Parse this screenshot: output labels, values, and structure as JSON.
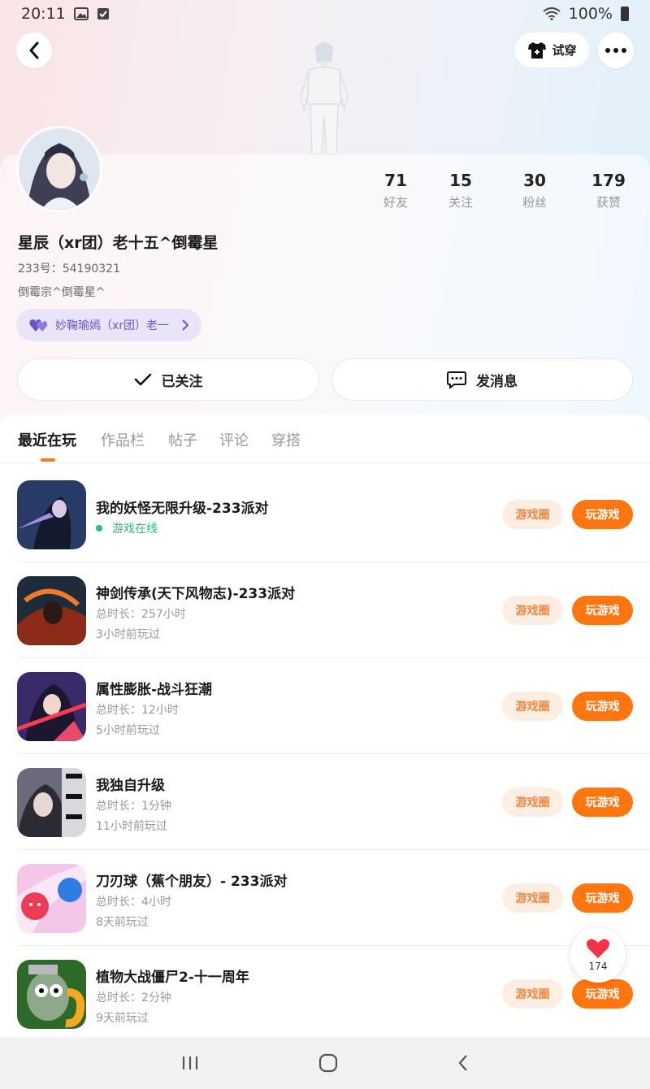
{
  "status_bar": {
    "time": "20:11",
    "battery": "100%"
  },
  "header": {
    "tryon_label": "试穿"
  },
  "profile": {
    "stats": [
      {
        "num": "71",
        "label": "好友"
      },
      {
        "num": "15",
        "label": "关注"
      },
      {
        "num": "30",
        "label": "粉丝"
      },
      {
        "num": "179",
        "label": "获赞"
      }
    ],
    "name": "星辰（xr团）老十五^倒霉星",
    "id_label": "233号：",
    "id_value": "54190321",
    "bio": "倒霉宗^倒霉星^",
    "family_tag": "妙鞠瑜嫣（xr团）老一",
    "follow_label": "已关注",
    "message_label": "发消息"
  },
  "tabs": [
    "最近在玩",
    "作品栏",
    "帖子",
    "评论",
    "穿搭"
  ],
  "games": [
    {
      "title": "我的妖怪无限升级-233派对",
      "online": "游戏在线",
      "duration": "",
      "last_played": ""
    },
    {
      "title": "神剑传承(天下风物志)-233派对",
      "online": "",
      "duration": "总时长：257小时",
      "last_played": "3小时前玩过"
    },
    {
      "title": "属性膨胀-战斗狂潮",
      "online": "",
      "duration": "总时长：12小时",
      "last_played": "5小时前玩过"
    },
    {
      "title": "我独自升级",
      "online": "",
      "duration": "总时长：1分钟",
      "last_played": "11小时前玩过"
    },
    {
      "title": "刀刃球（蕉个朋友）- 233派对",
      "online": "",
      "duration": "总时长：4小时",
      "last_played": "8天前玩过"
    },
    {
      "title": "植物大战僵尸2-十一周年",
      "online": "",
      "duration": "总时长：2分钟",
      "last_played": "9天前玩过"
    }
  ],
  "game_buttons": {
    "circle": "游戏圈",
    "play": "玩游戏"
  },
  "like_float": {
    "count": "174"
  },
  "colors": {
    "accent": "#ff7510",
    "accent_light": "#fdeee4",
    "online": "#22c27a",
    "family_tag": "#6d55c9"
  }
}
